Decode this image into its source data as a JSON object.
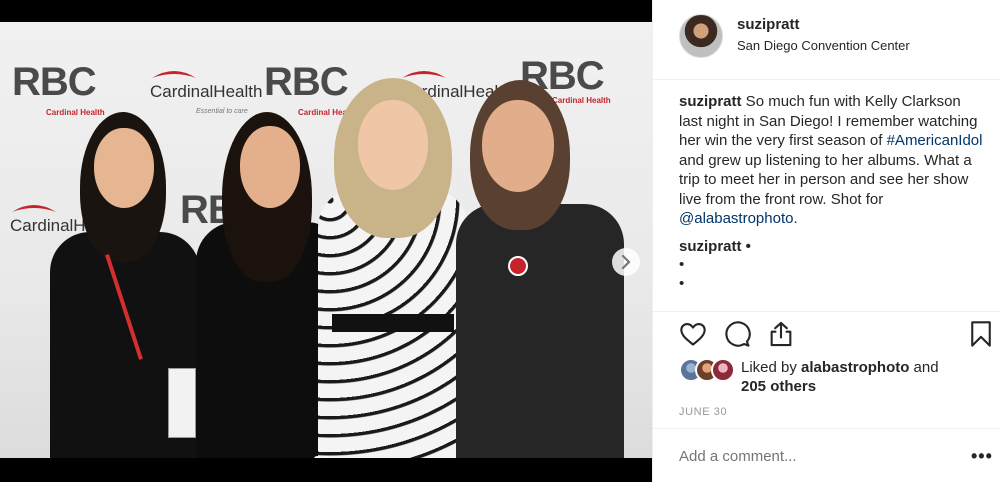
{
  "photo": {
    "backdrop_logos": {
      "rbc": "RBC",
      "rbc_sub": "Cardinal Health",
      "ch": "CardinalHealth",
      "ch_sub": "Essential to care"
    },
    "carousel": {
      "total": 2,
      "current": 1
    }
  },
  "post": {
    "username": "suzipratt",
    "location": "San Diego Convention Center",
    "caption": {
      "user": "suzipratt",
      "text_1": " So much fun with Kelly Clarkson last night in San Diego! I remember watching her win the very first season of ",
      "hashtag": "#AmericanIdol",
      "text_2": " and grew up listening to her albums. What a trip to meet her in person and see her show live from the front row. Shot for ",
      "mention": "@alabastrophoto",
      "text_3": "."
    },
    "comment": {
      "user": "suzipratt",
      "suffix": " •",
      "bullets": [
        "•",
        "•"
      ]
    },
    "likes": {
      "prefix": "Liked by ",
      "user": "alabastrophoto",
      "middle": " and",
      "others": "205 others"
    },
    "date": "JUNE 30",
    "comment_placeholder": "Add a comment...",
    "more": "•••"
  },
  "icons": {
    "like": "heart-icon",
    "comment": "comment-bubble-icon",
    "share": "share-icon",
    "save": "bookmark-icon",
    "next": "chevron-right-icon"
  },
  "colors": {
    "link": "#003569",
    "text": "#262626",
    "muted": "#999999",
    "brand_red": "#c8232c"
  }
}
